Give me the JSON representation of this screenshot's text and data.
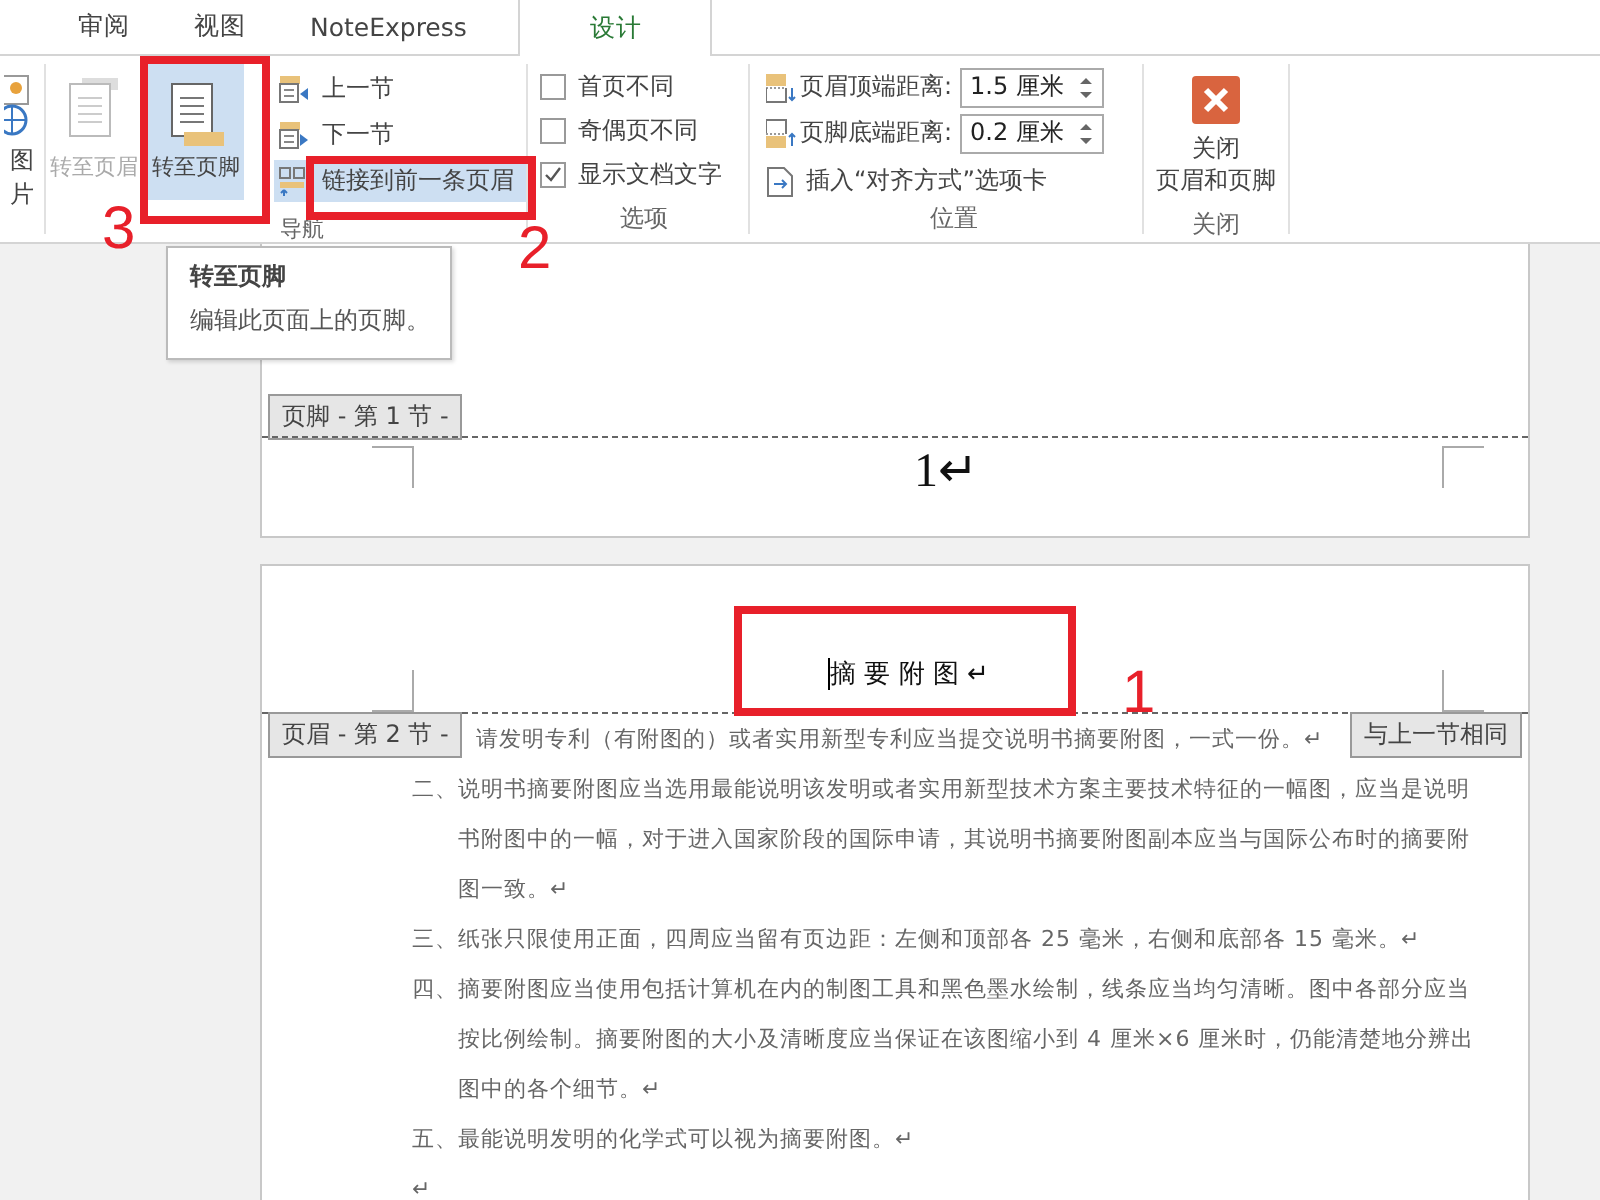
{
  "tabs": [
    {
      "label": "审阅",
      "selected": false
    },
    {
      "label": "视图",
      "selected": false
    },
    {
      "label": "NoteExpress",
      "selected": false
    },
    {
      "label": "设计",
      "selected": true
    }
  ],
  "ribbon": {
    "picture_button": {
      "label": "图片"
    },
    "navigation": {
      "label": "导航",
      "large_buttons": [
        {
          "kind": "header",
          "label": "转至页眉",
          "disabled": true,
          "selected": false
        },
        {
          "kind": "footer",
          "label": "转至页脚",
          "disabled": false,
          "selected": true
        }
      ],
      "small_buttons": [
        {
          "kind": "prev",
          "label": "上一节",
          "selected": false
        },
        {
          "kind": "next",
          "label": "下一节",
          "selected": false
        },
        {
          "kind": "link",
          "label": "链接到前一条页眉",
          "selected": true
        }
      ]
    },
    "options": {
      "label": "选项",
      "checkboxes": [
        {
          "label": "首页不同",
          "checked": false
        },
        {
          "label": "奇偶页不同",
          "checked": false
        },
        {
          "label": "显示文档文字",
          "checked": true
        }
      ]
    },
    "position": {
      "label": "位置",
      "fields": [
        {
          "kind": "top",
          "label": "页眉顶端距离:",
          "value": "1.5 厘米"
        },
        {
          "kind": "bottom",
          "label": "页脚底端距离:",
          "value": "0.2 厘米"
        }
      ],
      "insert_button": {
        "label": "插入“对齐方式”选项卡"
      }
    },
    "close": {
      "label": "关闭",
      "button": {
        "lines": [
          "关闭",
          "页眉和页脚"
        ]
      }
    }
  },
  "tooltip": {
    "title": "转至页脚",
    "text": "编辑此页面上的页脚。"
  },
  "page1": {
    "footer_tag": "页脚 - 第 1 节 -",
    "page_number": "1↵"
  },
  "page2": {
    "header_text": "摘 要 附 图 ↵",
    "header_tag": "页眉 - 第 2 节 -",
    "same_as_previous": "与上一节相同",
    "paragraphs": [
      {
        "kind": "partial",
        "text": "请发明专利（有附图的）或者实用新型专利应当提交说明书摘要附图，一式一份。↵"
      },
      {
        "kind": "item",
        "text": "二、说明书摘要附图应当选用最能说明该发明或者实用新型技术方案主要技术特征的一幅图，应当是说明书附图中的一幅，对于进入国家阶段的国际申请，其说明书摘要附图副本应当与国际公布时的摘要附图一致。↵"
      },
      {
        "kind": "item",
        "text": "三、纸张只限使用正面，四周应当留有页边距：左侧和顶部各 25 毫米，右侧和底部各 15 毫米。↵"
      },
      {
        "kind": "item",
        "text": "四、摘要附图应当使用包括计算机在内的制图工具和黑色墨水绘制，线条应当均匀清晰。图中各部分应当按比例绘制。摘要附图的大小及清晰度应当保证在该图缩小到 4 厘米×6 厘米时，仍能清楚地分辨出图中的各个细节。↵"
      },
      {
        "kind": "item",
        "text": "五、最能说明发明的化学式可以视为摘要附图。↵"
      },
      {
        "kind": "item",
        "text": "↵"
      }
    ]
  },
  "annotations": [
    {
      "number": "1"
    },
    {
      "number": "2"
    },
    {
      "number": "3"
    }
  ]
}
